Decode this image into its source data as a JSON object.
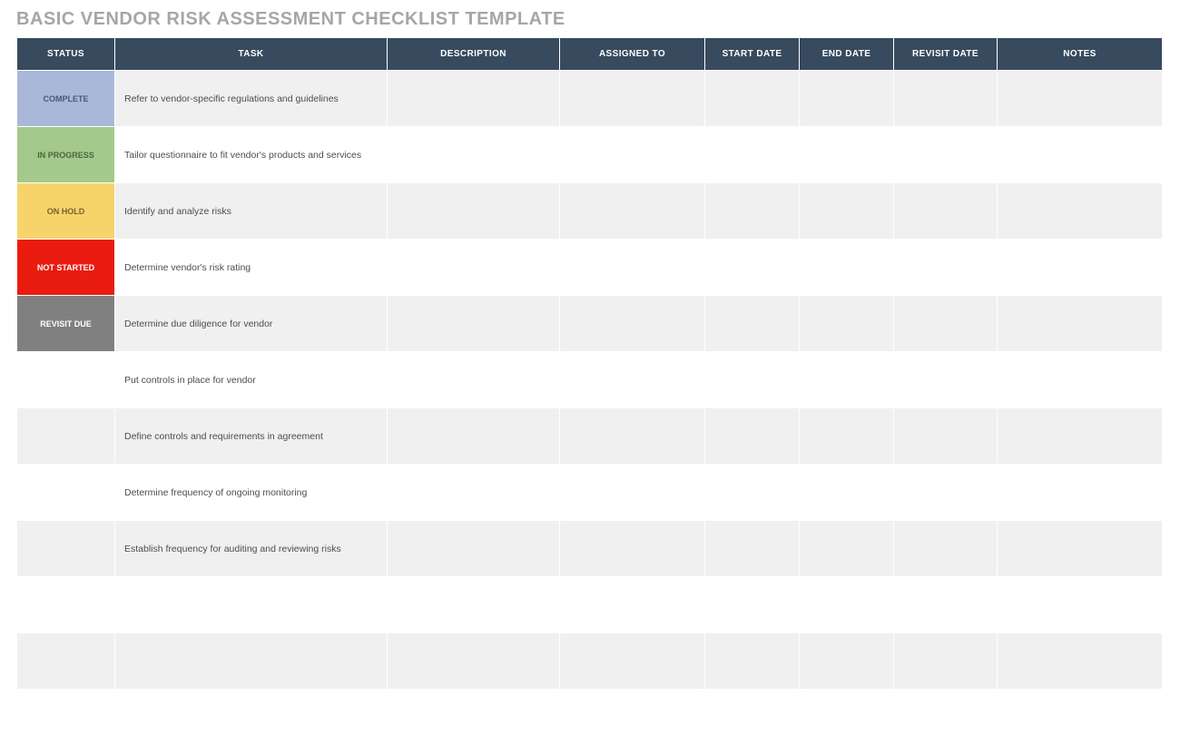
{
  "title": "BASIC VENDOR RISK ASSESSMENT CHECKLIST TEMPLATE",
  "columns": {
    "status": "STATUS",
    "task": "TASK",
    "description": "DESCRIPTION",
    "assigned_to": "ASSIGNED TO",
    "start_date": "START DATE",
    "end_date": "END DATE",
    "revisit_date": "REVISIT DATE",
    "notes": "NOTES"
  },
  "status_labels": {
    "complete": "COMPLETE",
    "in_progress": "IN PROGRESS",
    "on_hold": "ON HOLD",
    "not_started": "NOT STARTED",
    "revisit_due": "REVISIT DUE"
  },
  "rows": [
    {
      "status_key": "complete",
      "task": "Refer to vendor-specific regulations and guidelines",
      "description": "",
      "assigned_to": "",
      "start_date": "",
      "end_date": "",
      "revisit_date": "",
      "notes": ""
    },
    {
      "status_key": "in_progress",
      "task": "Tailor questionnaire to fit vendor's products and services",
      "description": "",
      "assigned_to": "",
      "start_date": "",
      "end_date": "",
      "revisit_date": "",
      "notes": ""
    },
    {
      "status_key": "on_hold",
      "task": "Identify and analyze risks",
      "description": "",
      "assigned_to": "",
      "start_date": "",
      "end_date": "",
      "revisit_date": "",
      "notes": ""
    },
    {
      "status_key": "not_started",
      "task": "Determine vendor's risk rating",
      "description": "",
      "assigned_to": "",
      "start_date": "",
      "end_date": "",
      "revisit_date": "",
      "notes": ""
    },
    {
      "status_key": "revisit_due",
      "task": "Determine due diligence for vendor",
      "description": "",
      "assigned_to": "",
      "start_date": "",
      "end_date": "",
      "revisit_date": "",
      "notes": ""
    },
    {
      "status_key": "",
      "task": "Put controls in place for vendor",
      "description": "",
      "assigned_to": "",
      "start_date": "",
      "end_date": "",
      "revisit_date": "",
      "notes": ""
    },
    {
      "status_key": "",
      "task": "Define controls and requirements in agreement",
      "description": "",
      "assigned_to": "",
      "start_date": "",
      "end_date": "",
      "revisit_date": "",
      "notes": ""
    },
    {
      "status_key": "",
      "task": "Determine frequency of ongoing monitoring",
      "description": "",
      "assigned_to": "",
      "start_date": "",
      "end_date": "",
      "revisit_date": "",
      "notes": ""
    },
    {
      "status_key": "",
      "task": "Establish frequency for auditing and reviewing risks",
      "description": "",
      "assigned_to": "",
      "start_date": "",
      "end_date": "",
      "revisit_date": "",
      "notes": ""
    },
    {
      "status_key": "",
      "task": "",
      "description": "",
      "assigned_to": "",
      "start_date": "",
      "end_date": "",
      "revisit_date": "",
      "notes": ""
    },
    {
      "status_key": "",
      "task": "",
      "description": "",
      "assigned_to": "",
      "start_date": "",
      "end_date": "",
      "revisit_date": "",
      "notes": ""
    },
    {
      "status_key": "",
      "task": "",
      "description": "",
      "assigned_to": "",
      "start_date": "",
      "end_date": "",
      "revisit_date": "",
      "notes": ""
    }
  ],
  "status_class_map": {
    "complete": "status-complete",
    "in_progress": "status-in-progress",
    "on_hold": "status-on-hold",
    "not_started": "status-not-started",
    "revisit_due": "status-revisit-due"
  }
}
